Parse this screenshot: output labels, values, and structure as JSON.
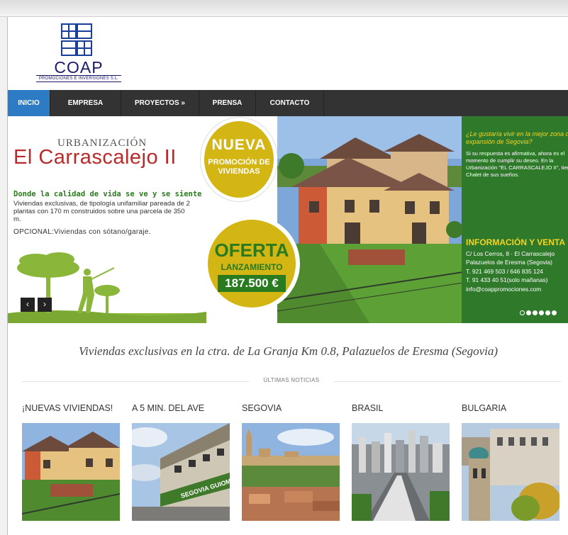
{
  "logo": {
    "name": "COAP",
    "tagline": "PROMOCIONES E INVERSIONES S.L."
  },
  "nav": [
    {
      "label": "INICIO",
      "active": true
    },
    {
      "label": "EMPRESA"
    },
    {
      "label": "PROYECTOS »"
    },
    {
      "label": "PRENSA"
    },
    {
      "label": "CONTACTO"
    }
  ],
  "slide": {
    "pre_title": "URBANIZACIÓN",
    "title": "El Carrascalejo II",
    "claim": "Donde la calidad de vida se ve y se siente",
    "description": "Viviendas exclusivas, de tipología unifamiliar pareada de 2 plantas con 170 m construidos sobre una parcela de 350 m.",
    "optional": "OPCIONAL:Viviendas con sótano/garaje.",
    "bubble_top_line1": "NUEVA",
    "bubble_top_line2": "PROMOCIÓN DE VIVIENDAS",
    "offer_line1": "OFERTA",
    "offer_line2": "LANZAMIENTO",
    "offer_price": "187.500 €",
    "question": "¿Le gustaría vivir en la mejor zona de expansión de Segovia?",
    "answer": "Si su respuesta es afirmativa, ahora es el momento de cumplir su deseo. En la Urbanización \"EL CARRASCALEJO II\", tiene el Chalet de sus sueños.",
    "info_title": "INFORMACIÓN Y VENTA",
    "address1": "C/ Los Cerros, 8 · El Carrascalejo",
    "address2": "Palazuelos de Eresma (Segovia)",
    "phone1": "T. 921 469 503 / 646 835 124",
    "phone2": "T. 91 433 40 51(solo mañanas)",
    "email": "info@coappromociones.com",
    "prev_icon": "‹",
    "next_icon": "›"
  },
  "slogan": "Viviendas exclusivas en la ctra. de La Granja Km 0.8, Palazuelos de Eresma (Segovia)",
  "section_label": "ÚLTIMAS NOTICIAS",
  "news": [
    {
      "title": "¡NUEVAS VIVIENDAS!"
    },
    {
      "title": "A 5 MIN. DEL AVE"
    },
    {
      "title": "SEGOVIA"
    },
    {
      "title": "BRASIL"
    },
    {
      "title": "BULGARIA"
    }
  ],
  "thumb_sign": "SEGOVIA GUIOMAR",
  "colors": {
    "nav_bg": "#333333",
    "nav_active": "#2d7bc4",
    "accent_red": "#b92a2a",
    "accent_green": "#2e7a2a",
    "accent_yellow": "#d3b514"
  }
}
